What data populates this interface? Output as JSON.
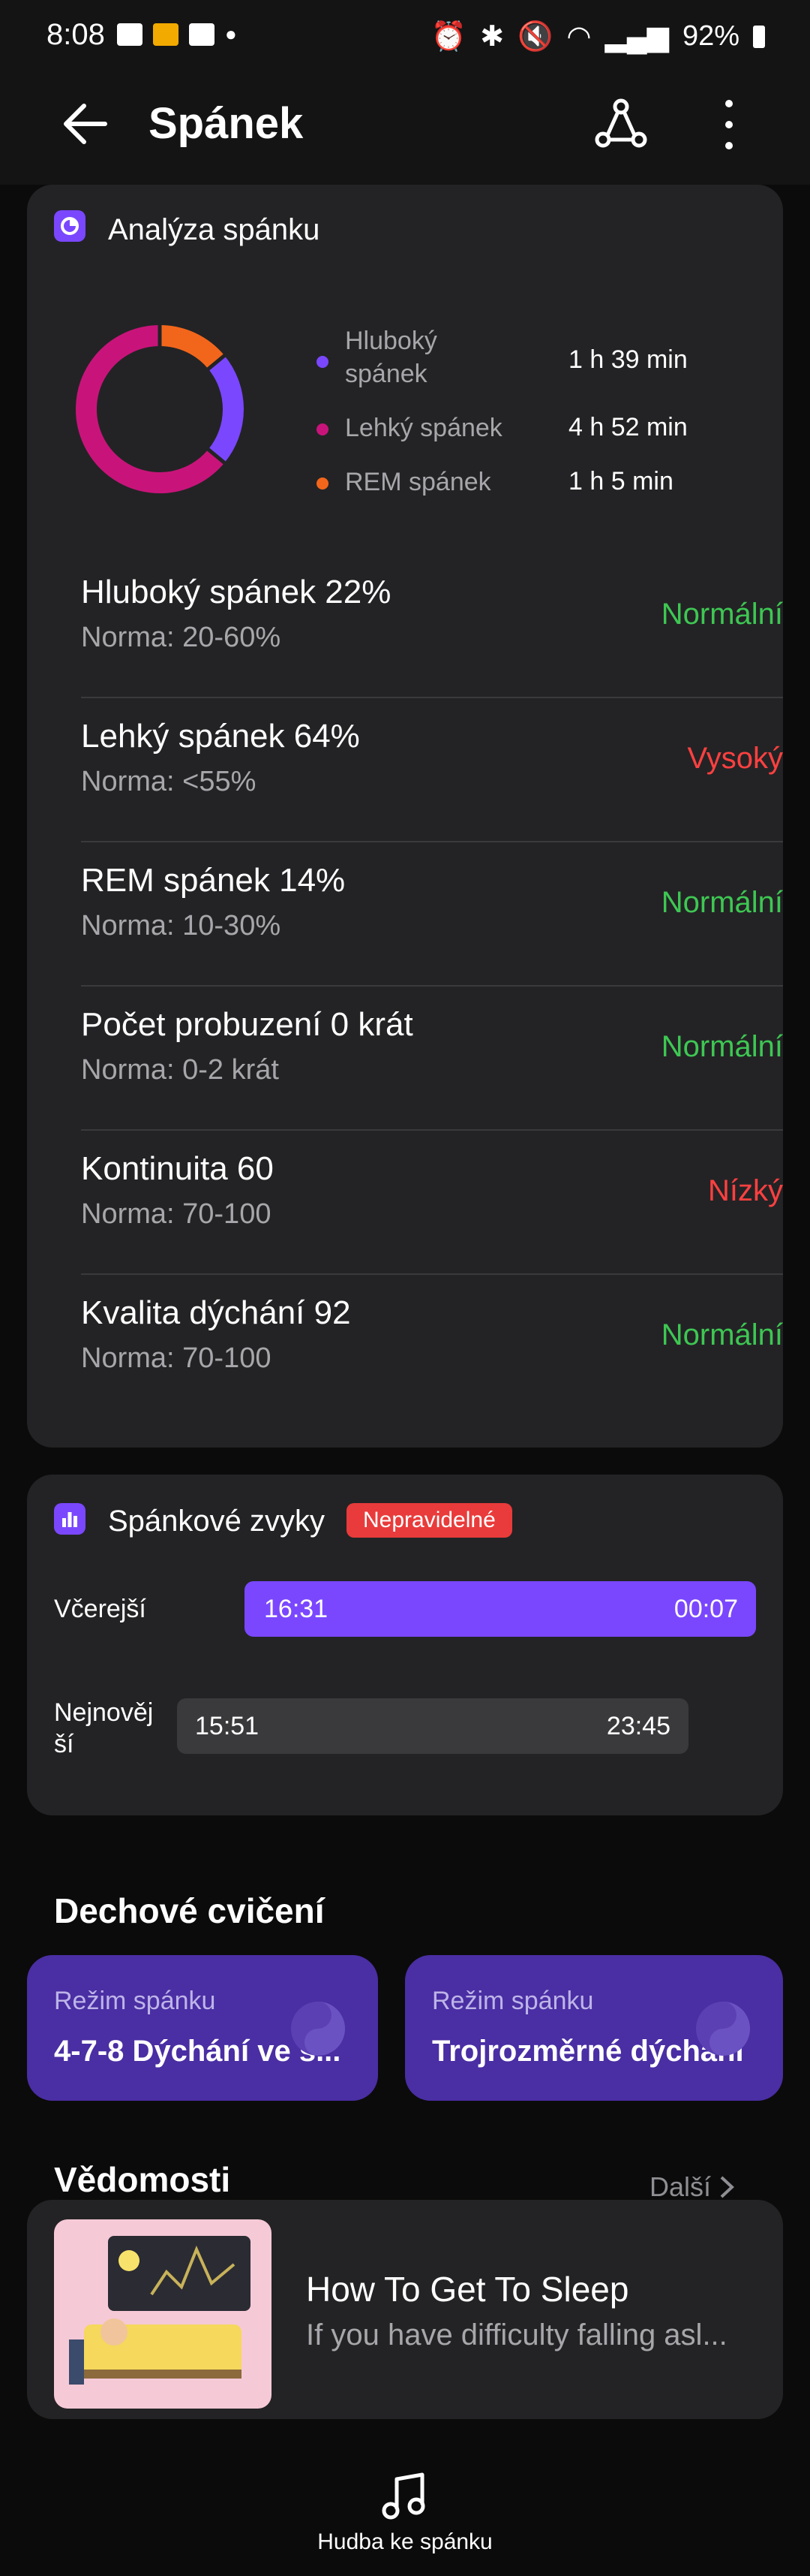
{
  "status_bar": {
    "time": "8:08",
    "battery": "92%"
  },
  "appbar": {
    "title": "Spánek"
  },
  "analysis": {
    "title": "Analýza spánku",
    "legend": [
      {
        "label": "Hluboký spánek",
        "value": "1 h 39 min",
        "color": "#7a47ff"
      },
      {
        "label": "Lehký spánek",
        "value": "4 h 52 min",
        "color": "#c8147a"
      },
      {
        "label": "REM spánek",
        "value": "1 h 5 min",
        "color": "#f2661b"
      }
    ],
    "donut_fractions": {
      "deep": 0.22,
      "light": 0.64,
      "rem": 0.14
    },
    "rows": [
      {
        "name": "Hluboký spánek 22%",
        "norm": "Norma: 20-60%",
        "status": "Normální"
      },
      {
        "name": "Lehký spánek 64%",
        "norm": "Norma: <55%",
        "status": "Vysoký"
      },
      {
        "name": "REM spánek 14%",
        "norm": "Norma: 10-30%",
        "status": "Normální"
      },
      {
        "name": "Počet probuzení 0 krát",
        "norm": "Norma: 0-2 krát",
        "status": "Normální"
      },
      {
        "name": "Kontinuita 60",
        "norm": "Norma: 70-100",
        "status": "Nízký"
      },
      {
        "name": "Kvalita dýchání 92",
        "norm": "Norma: 70-100",
        "status": "Normální"
      }
    ]
  },
  "habits": {
    "title": "Spánkové zvyky",
    "badge": "Nepravidelné",
    "yesterday": {
      "label": "Včerejší",
      "start": "16:31",
      "end": "00:07"
    },
    "latest": {
      "label": "Nejnovější",
      "start": "15:51",
      "end": "23:45"
    }
  },
  "breathing": {
    "title": "Dechové cvičení",
    "cards": [
      {
        "label": "Režim spánku",
        "title": "4-7-8 Dýchání ve s..."
      },
      {
        "label": "Režim spánku",
        "title": "Trojrozměrné dýchání"
      }
    ]
  },
  "news": {
    "title": "Vědomosti",
    "more": "Další",
    "item": {
      "title": "How To Get To Sleep",
      "subtitle": "If you have difficulty falling asl..."
    }
  },
  "bottom_nav": {
    "label": "Hudba ke spánku"
  }
}
